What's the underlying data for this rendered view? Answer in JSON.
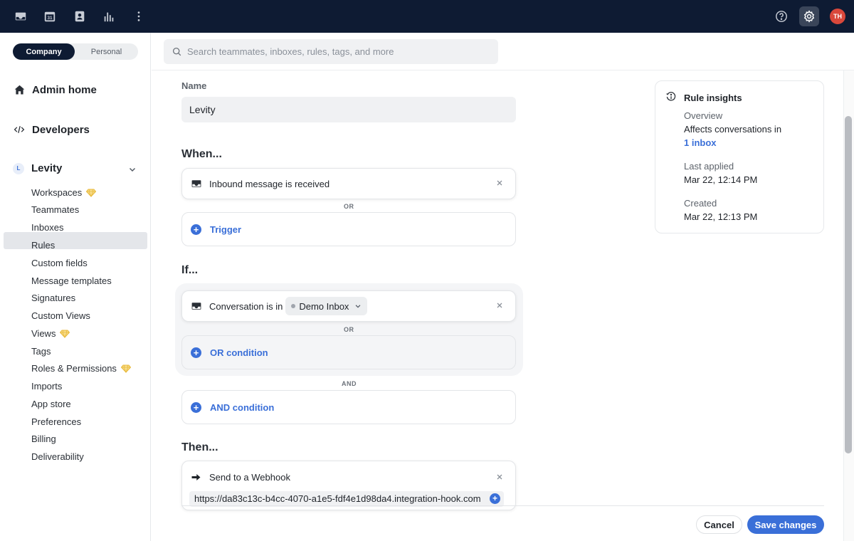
{
  "topbar": {
    "calendar_day": "31",
    "avatar_initials": "TH"
  },
  "sidebar": {
    "segment": {
      "company": "Company",
      "personal": "Personal"
    },
    "admin_home": "Admin home",
    "developers": "Developers",
    "workspace_badge": "L",
    "workspace_name": "Levity",
    "items": [
      {
        "label": "Workspaces",
        "premium": true
      },
      {
        "label": "Teammates",
        "premium": false
      },
      {
        "label": "Inboxes",
        "premium": false
      },
      {
        "label": "Rules",
        "premium": false,
        "active": true
      },
      {
        "label": "Custom fields",
        "premium": false
      },
      {
        "label": "Message templates",
        "premium": false
      },
      {
        "label": "Signatures",
        "premium": false
      },
      {
        "label": "Custom Views",
        "premium": false
      },
      {
        "label": "Views",
        "premium": true
      },
      {
        "label": "Tags",
        "premium": false
      },
      {
        "label": "Roles & Permissions",
        "premium": true
      },
      {
        "label": "Imports",
        "premium": false
      },
      {
        "label": "App store",
        "premium": false
      },
      {
        "label": "Preferences",
        "premium": false
      },
      {
        "label": "Billing",
        "premium": false
      },
      {
        "label": "Deliverability",
        "premium": false
      }
    ]
  },
  "search": {
    "placeholder": "Search teammates, inboxes, rules, tags, and more"
  },
  "rule": {
    "name_label": "Name",
    "name_value": "Levity",
    "when_heading": "When...",
    "trigger_condition": "Inbound message is received",
    "or_label": "OR",
    "add_trigger": "Trigger",
    "if_heading": "If...",
    "if_condition_prefix": "Conversation is in",
    "if_condition_inbox": "Demo Inbox",
    "add_or_condition": "OR condition",
    "and_label": "AND",
    "add_and_condition": "AND condition",
    "then_heading": "Then...",
    "action": "Send to a Webhook",
    "webhook_url": "https://da83c13c-b4cc-4070-a1e5-fdf4e1d98da4.integration-hook.com"
  },
  "insights": {
    "title": "Rule insights",
    "overview_label": "Overview",
    "overview_text": "Affects conversations in",
    "overview_link": "1 inbox",
    "last_applied_label": "Last applied",
    "last_applied_value": "Mar 22, 12:14 PM",
    "created_label": "Created",
    "created_value": "Mar 22, 12:13 PM"
  },
  "footer": {
    "cancel": "Cancel",
    "save": "Save changes"
  },
  "colors": {
    "topbar": "#0e1b33",
    "accent": "#3a6fd8",
    "avatar": "#d9483b",
    "premium_gem": "#e8b93a"
  }
}
